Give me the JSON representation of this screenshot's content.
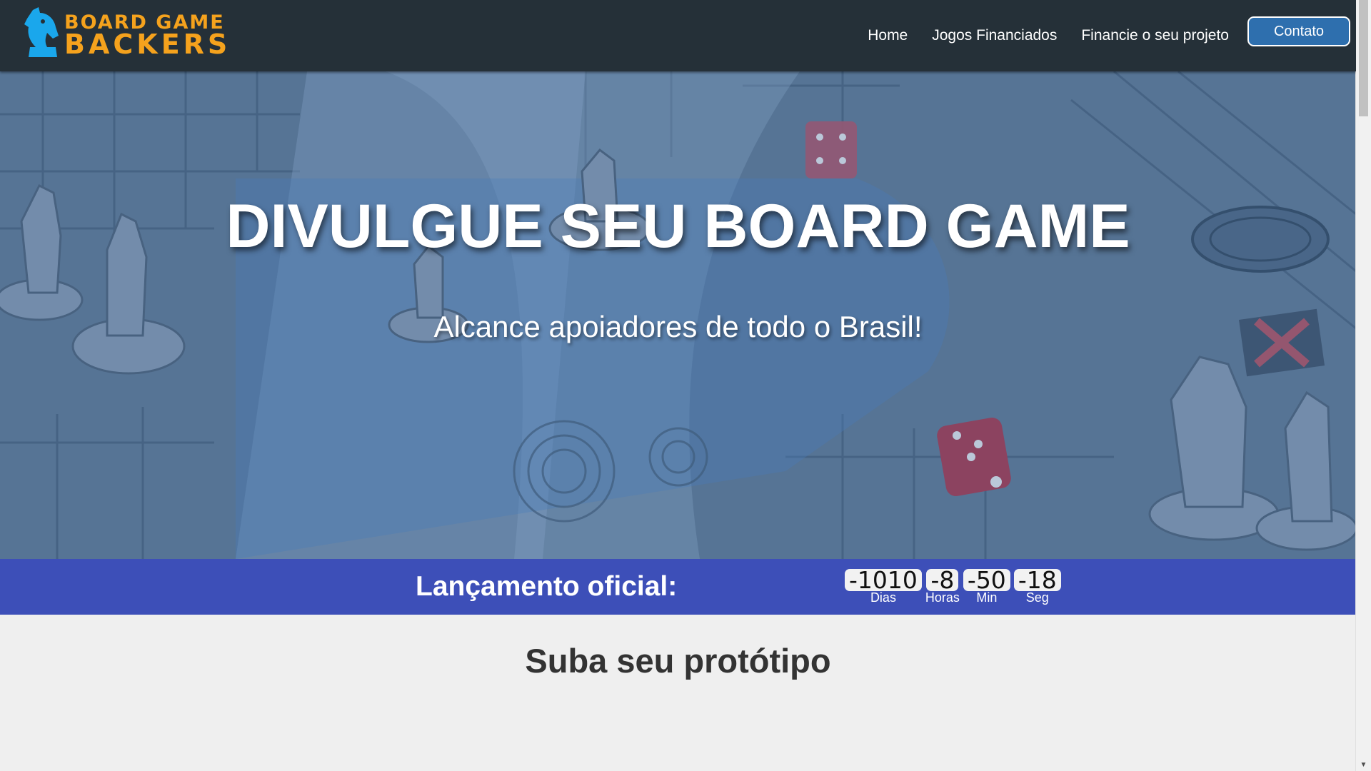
{
  "brand": {
    "line1": "BOARD GAME",
    "line2": "BACKERS",
    "logo_icon": "knight-chess-piece-icon",
    "logo_color": "#1aa7ec",
    "text_color": "#f5a21d"
  },
  "nav": {
    "links": [
      "Home",
      "Jogos Financiados",
      "Financie o seu projeto"
    ],
    "contact_label": "Contato",
    "background": "#253038"
  },
  "hero": {
    "title": "DIVULGUE SEU BOARD GAME",
    "subtitle": "Alcance apoiadores de todo o Brasil!"
  },
  "launch": {
    "label": "Lançamento oficial:",
    "background": "#3d4fb8",
    "countdown": [
      {
        "value": "-1010",
        "unit": "Dias"
      },
      {
        "value": "-8",
        "unit": "Horas"
      },
      {
        "value": "-50",
        "unit": "Min"
      },
      {
        "value": "-18",
        "unit": "Seg"
      }
    ]
  },
  "section": {
    "title": "Suba seu protótipo"
  }
}
